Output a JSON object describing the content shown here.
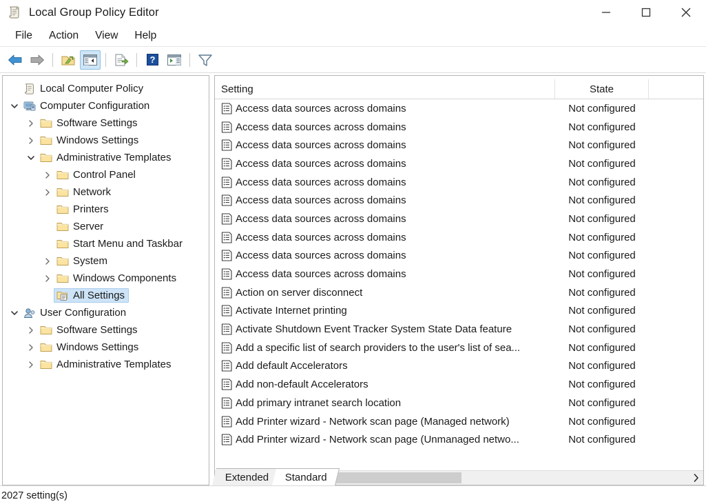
{
  "window": {
    "title": "Local Group Policy Editor",
    "icon": "policy-scroll-icon",
    "controls": {
      "minimize": "minimize-button",
      "maximize": "maximize-button",
      "close": "close-button"
    }
  },
  "menubar": {
    "items": [
      {
        "label": "File"
      },
      {
        "label": "Action"
      },
      {
        "label": "View"
      },
      {
        "label": "Help"
      }
    ]
  },
  "toolbar": {
    "buttons": [
      {
        "name": "back-button",
        "icon": "arrow-left-icon",
        "active": false
      },
      {
        "name": "forward-button",
        "icon": "arrow-right-icon",
        "active": false
      },
      {
        "name": "up-one-level-button",
        "icon": "folder-up-icon",
        "active": false
      },
      {
        "name": "show-hide-console-tree-button",
        "icon": "console-tree-icon",
        "active": true
      },
      {
        "name": "export-list-button",
        "icon": "export-list-icon",
        "active": false
      },
      {
        "name": "help-button",
        "icon": "question-mark-icon",
        "active": false
      },
      {
        "name": "show-hide-action-pane-button",
        "icon": "action-pane-icon",
        "active": false
      },
      {
        "name": "filter-button",
        "icon": "funnel-filter-icon",
        "active": false
      }
    ]
  },
  "tree": {
    "items": [
      {
        "label": "Local Computer Policy",
        "depth": 0,
        "twisty": "none",
        "icon": "policy-scroll-icon",
        "selected": false
      },
      {
        "label": "Computer Configuration",
        "depth": 0,
        "twisty": "expanded",
        "icon": "computer-icon",
        "selected": false
      },
      {
        "label": "Software Settings",
        "depth": 1,
        "twisty": "collapsed",
        "icon": "folder-icon",
        "selected": false
      },
      {
        "label": "Windows Settings",
        "depth": 1,
        "twisty": "collapsed",
        "icon": "folder-icon",
        "selected": false
      },
      {
        "label": "Administrative Templates",
        "depth": 1,
        "twisty": "expanded",
        "icon": "folder-icon",
        "selected": false
      },
      {
        "label": "Control Panel",
        "depth": 2,
        "twisty": "collapsed",
        "icon": "folder-icon",
        "selected": false
      },
      {
        "label": "Network",
        "depth": 2,
        "twisty": "collapsed",
        "icon": "folder-icon",
        "selected": false
      },
      {
        "label": "Printers",
        "depth": 2,
        "twisty": "none",
        "icon": "folder-icon",
        "selected": false
      },
      {
        "label": "Server",
        "depth": 2,
        "twisty": "none",
        "icon": "folder-icon",
        "selected": false
      },
      {
        "label": "Start Menu and Taskbar",
        "depth": 2,
        "twisty": "none",
        "icon": "folder-icon",
        "selected": false
      },
      {
        "label": "System",
        "depth": 2,
        "twisty": "collapsed",
        "icon": "folder-icon",
        "selected": false
      },
      {
        "label": "Windows Components",
        "depth": 2,
        "twisty": "collapsed",
        "icon": "folder-icon",
        "selected": false
      },
      {
        "label": "All Settings",
        "depth": 2,
        "twisty": "none",
        "icon": "all-settings-icon",
        "selected": true
      },
      {
        "label": "User Configuration",
        "depth": 0,
        "twisty": "expanded",
        "icon": "user-icon",
        "selected": false
      },
      {
        "label": "Software Settings",
        "depth": 1,
        "twisty": "collapsed",
        "icon": "folder-icon",
        "selected": false
      },
      {
        "label": "Windows Settings",
        "depth": 1,
        "twisty": "collapsed",
        "icon": "folder-icon",
        "selected": false
      },
      {
        "label": "Administrative Templates",
        "depth": 1,
        "twisty": "collapsed",
        "icon": "folder-icon",
        "selected": false
      }
    ]
  },
  "list": {
    "sort_indicator": "^",
    "columns": [
      {
        "label": "Setting",
        "key": "setting"
      },
      {
        "label": "State",
        "key": "state"
      }
    ],
    "rows": [
      {
        "setting": "Access data sources across domains",
        "state": "Not configured"
      },
      {
        "setting": "Access data sources across domains",
        "state": "Not configured"
      },
      {
        "setting": "Access data sources across domains",
        "state": "Not configured"
      },
      {
        "setting": "Access data sources across domains",
        "state": "Not configured"
      },
      {
        "setting": "Access data sources across domains",
        "state": "Not configured"
      },
      {
        "setting": "Access data sources across domains",
        "state": "Not configured"
      },
      {
        "setting": "Access data sources across domains",
        "state": "Not configured"
      },
      {
        "setting": "Access data sources across domains",
        "state": "Not configured"
      },
      {
        "setting": "Access data sources across domains",
        "state": "Not configured"
      },
      {
        "setting": "Access data sources across domains",
        "state": "Not configured"
      },
      {
        "setting": "Action on server disconnect",
        "state": "Not configured"
      },
      {
        "setting": "Activate Internet printing",
        "state": "Not configured"
      },
      {
        "setting": "Activate Shutdown Event Tracker System State Data feature",
        "state": "Not configured"
      },
      {
        "setting": "Add a specific list of search providers to the user's list of sea...",
        "state": "Not configured"
      },
      {
        "setting": "Add default Accelerators",
        "state": "Not configured"
      },
      {
        "setting": "Add non-default Accelerators",
        "state": "Not configured"
      },
      {
        "setting": "Add primary intranet search location",
        "state": "Not configured"
      },
      {
        "setting": "Add Printer wizard - Network scan page (Managed network)",
        "state": "Not configured"
      },
      {
        "setting": "Add Printer wizard - Network scan page (Unmanaged netwo...",
        "state": "Not configured"
      }
    ]
  },
  "scrollbar": {
    "left_arrow": "‹",
    "right_arrow": "›"
  },
  "tabs": [
    {
      "label": "Extended",
      "active": false
    },
    {
      "label": "Standard",
      "active": true
    }
  ],
  "statusbar": {
    "text": "2027 setting(s)"
  },
  "colors": {
    "selection": "#cde3f7",
    "toolbar_active": "#cfe5f7",
    "text": "#1b1b1b",
    "border": "#b5b5b5",
    "scroll_thumb": "#cdcdcd",
    "folder": "#fbe3a0"
  }
}
